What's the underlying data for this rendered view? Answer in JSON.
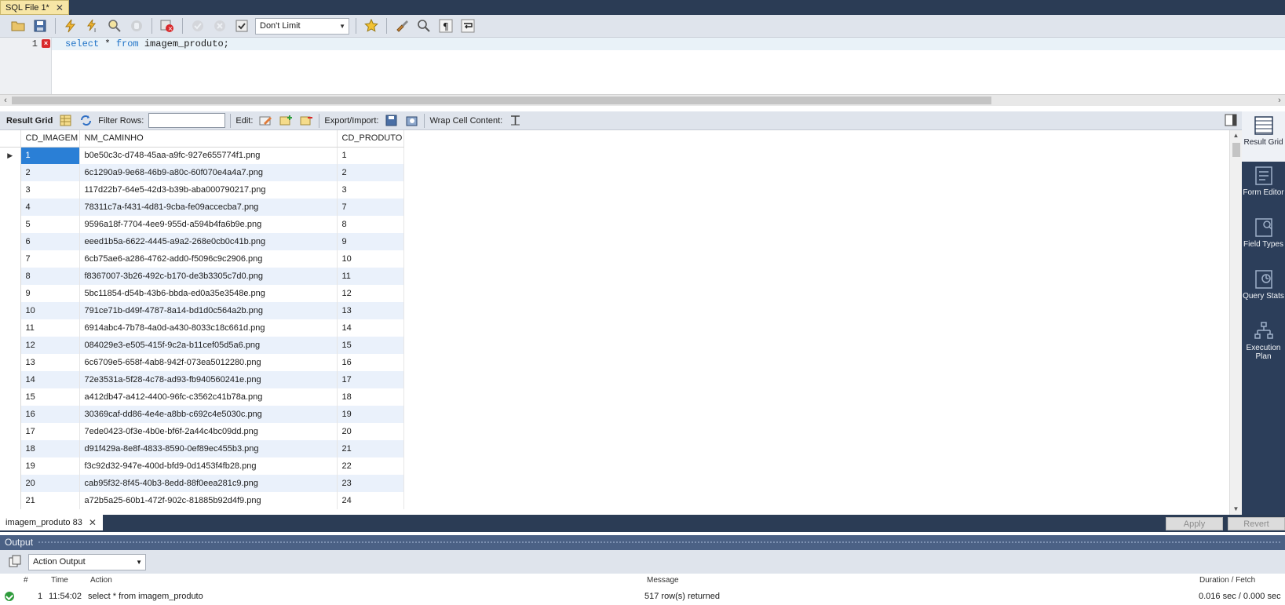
{
  "tab": {
    "title": "SQL File 1*",
    "close": "✕"
  },
  "toolbar": {
    "limit_value": "Don't Limit",
    "buttons": [
      "open-file",
      "save",
      "execute",
      "execute-current",
      "explain",
      "stop",
      "toggle-error",
      "commit",
      "rollback",
      "bookmark",
      "beautify",
      "find",
      "invisible-chars",
      "wrap"
    ]
  },
  "editor": {
    "line_number": "1",
    "keyword_select": "select",
    "star": "*",
    "keyword_from": "from",
    "table": "imagem_produto;"
  },
  "result_toolbar": {
    "result_grid": "Result Grid",
    "filter_rows": "Filter Rows:",
    "edit": "Edit:",
    "export_import": "Export/Import:",
    "wrap_cell": "Wrap Cell Content:"
  },
  "grid": {
    "columns": [
      "CD_IMAGEM",
      "NM_CAMINHO",
      "CD_PRODUTO"
    ],
    "rows": [
      [
        "1",
        "b0e50c3c-d748-45aa-a9fc-927e655774f1.png",
        "1"
      ],
      [
        "2",
        "6c1290a9-9e68-46b9-a80c-60f070e4a4a7.png",
        "2"
      ],
      [
        "3",
        "117d22b7-64e5-42d3-b39b-aba000790217.png",
        "3"
      ],
      [
        "4",
        "78311c7a-f431-4d81-9cba-fe09accecba7.png",
        "7"
      ],
      [
        "5",
        "9596a18f-7704-4ee9-955d-a594b4fa6b9e.png",
        "8"
      ],
      [
        "6",
        "eeed1b5a-6622-4445-a9a2-268e0cb0c41b.png",
        "9"
      ],
      [
        "7",
        "6cb75ae6-a286-4762-add0-f5096c9c2906.png",
        "10"
      ],
      [
        "8",
        "f8367007-3b26-492c-b170-de3b3305c7d0.png",
        "11"
      ],
      [
        "9",
        "5bc11854-d54b-43b6-bbda-ed0a35e3548e.png",
        "12"
      ],
      [
        "10",
        "791ce71b-d49f-4787-8a14-bd1d0c564a2b.png",
        "13"
      ],
      [
        "11",
        "6914abc4-7b78-4a0d-a430-8033c18c661d.png",
        "14"
      ],
      [
        "12",
        "084029e3-e505-415f-9c2a-b11cef05d5a6.png",
        "15"
      ],
      [
        "13",
        "6c6709e5-658f-4ab8-942f-073ea5012280.png",
        "16"
      ],
      [
        "14",
        "72e3531a-5f28-4c78-ad93-fb940560241e.png",
        "17"
      ],
      [
        "15",
        "a412db47-a412-4400-96fc-c3562c41b78a.png",
        "18"
      ],
      [
        "16",
        "30369caf-dd86-4e4e-a8bb-c692c4e5030c.png",
        "19"
      ],
      [
        "17",
        "7ede0423-0f3e-4b0e-bf6f-2a44c4bc09dd.png",
        "20"
      ],
      [
        "18",
        "d91f429a-8e8f-4833-8590-0ef89ec455b3.png",
        "21"
      ],
      [
        "19",
        "f3c92d32-947e-400d-bfd9-0d1453f4fb28.png",
        "22"
      ],
      [
        "20",
        "cab95f32-8f45-40b3-8edd-88f0eea281c9.png",
        "23"
      ],
      [
        "21",
        "a72b5a25-60b1-472f-902c-81885b92d4f9.png",
        "24"
      ]
    ]
  },
  "side_panel": {
    "items": [
      {
        "label": "Result Grid",
        "icon": "result-grid-icon",
        "active": true
      },
      {
        "label": "Form Editor",
        "icon": "form-editor-icon",
        "active": false
      },
      {
        "label": "Field Types",
        "icon": "field-types-icon",
        "active": false
      },
      {
        "label": "Query Stats",
        "icon": "query-stats-icon",
        "active": false
      },
      {
        "label": "Execution Plan",
        "icon": "execution-plan-icon",
        "active": false
      }
    ]
  },
  "result_tab": {
    "title": "imagem_produto 83",
    "close": "✕",
    "apply": "Apply",
    "revert": "Revert"
  },
  "output": {
    "title": "Output",
    "selector": "Action Output",
    "headers": {
      "num": "#",
      "time": "Time",
      "action": "Action",
      "message": "Message",
      "duration": "Duration / Fetch"
    },
    "row": {
      "num": "1",
      "time": "11:54:02",
      "action": "select * from imagem_produto",
      "message": "517 row(s) returned",
      "duration": "0.016 sec / 0.000 sec"
    }
  },
  "colors": {
    "tab_active": "#f7e6a6",
    "chrome_dark": "#2b3c55",
    "selection": "#2a7fd6",
    "alt_row": "#eaf1fb",
    "keyword": "#1f73c7"
  }
}
